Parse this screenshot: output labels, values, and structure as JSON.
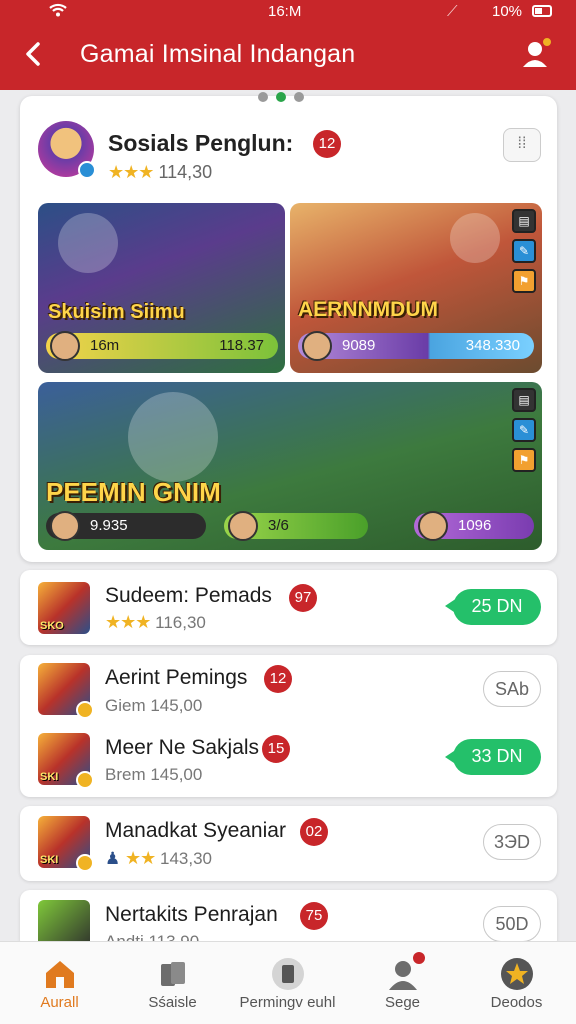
{
  "status_bar": {
    "time": "16:M",
    "battery": "10%"
  },
  "header": {
    "title": "Gamai Imsinal Indangan",
    "back_icon": "back-arrow-icon",
    "profile_icon": "profile-icon"
  },
  "featured": {
    "title": "Sosials Penglun:",
    "badge": "12",
    "rating_value": "114,30",
    "rating_stars": 3,
    "tiles": [
      {
        "title": "Skuisim Siimu",
        "bar_left": "16m",
        "bar_right": "118.37"
      },
      {
        "title": "AERNNMDUM",
        "bar_left": "9089",
        "bar_right": "348.330"
      },
      {
        "title": "PEEMIN GNIM",
        "bar_a": "9.935",
        "bar_b": "3/6",
        "bar_c": "1096"
      }
    ]
  },
  "list": [
    {
      "name": "Sudeem: Pemads",
      "badge": "97",
      "sub": "116,30",
      "stars": 3,
      "action": "25 DN",
      "action_style": "green",
      "thumb_tag": "SKO"
    },
    {
      "name": "Aerint Pemings",
      "badge": "12",
      "sub": "Giem 145,00",
      "action": "SAb",
      "action_style": "outline"
    },
    {
      "name": "Meer Ne Sakjals",
      "badge": "15",
      "sub": "Brem 145,00",
      "action": "33 DN",
      "action_style": "green",
      "thumb_tag": "SKI"
    },
    {
      "name": "Manadkat Syeaniar",
      "badge": "02",
      "sub": "143,30",
      "stars": 2,
      "action": "3ЭD",
      "action_style": "outline",
      "thumb_tag": "SKI"
    },
    {
      "name": "Nertakits Penrajan",
      "badge": "75",
      "sub": "Andti 113,90",
      "action": "50D",
      "action_style": "outline"
    }
  ],
  "nav": [
    {
      "label": "Aurall",
      "icon": "home-icon",
      "active": true
    },
    {
      "label": "Sśaisle",
      "icon": "cards-icon"
    },
    {
      "label": "Permingv euhl",
      "icon": "center-icon"
    },
    {
      "label": "Sege",
      "icon": "user-icon"
    },
    {
      "label": "Deodos",
      "icon": "star-icon"
    }
  ],
  "colors": {
    "header_red": "#c8262a",
    "accent_green": "#24c06a",
    "star_gold": "#f0b323",
    "nav_active": "#e07a1f"
  }
}
